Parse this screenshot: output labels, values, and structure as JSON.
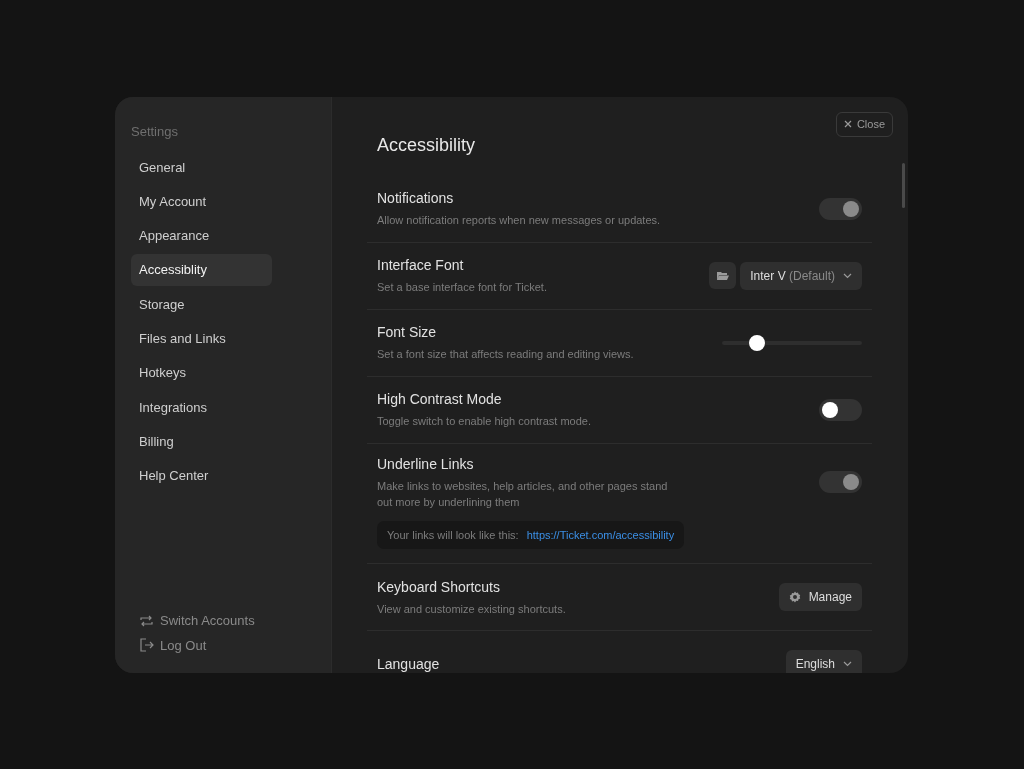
{
  "sidebar": {
    "heading": "Settings",
    "items": [
      {
        "label": "General",
        "selected": false
      },
      {
        "label": "My Account",
        "selected": false
      },
      {
        "label": "Appearance",
        "selected": false
      },
      {
        "label": "Accessiblity",
        "selected": true
      },
      {
        "label": "Storage",
        "selected": false
      },
      {
        "label": "Files and Links",
        "selected": false
      },
      {
        "label": "Hotkeys",
        "selected": false
      },
      {
        "label": "Integrations",
        "selected": false
      },
      {
        "label": "Billing",
        "selected": false
      },
      {
        "label": "Help Center",
        "selected": false
      }
    ],
    "footer": [
      {
        "kind": "switch",
        "label": "Switch Accounts"
      },
      {
        "kind": "logout",
        "label": "Log Out"
      }
    ]
  },
  "close_button": "Close",
  "title": "Accessibility",
  "settings": [
    {
      "kind": "toggle",
      "title": "Notifications",
      "description": "Allow notification reports when new messages or updates.",
      "on": true
    },
    {
      "kind": "font",
      "title": "Interface Font",
      "description": "Set a base interface font for Ticket.",
      "value": "Inter V",
      "note": "(Default)"
    },
    {
      "kind": "slider",
      "title": "Font Size",
      "description": "Set a font size that affects reading and editing views.",
      "level": 0.25
    },
    {
      "kind": "toggle",
      "title": "High Contrast Mode",
      "description": "Toggle switch to enable high contrast mode.",
      "on": false
    },
    {
      "kind": "toggle",
      "title": "Underline Links",
      "description": "Make links to websites, help articles, and other pages stand out more by underlining them",
      "on": true,
      "preview": {
        "text": "Your links will look like this:",
        "link": "https://Ticket.com/accessibility"
      }
    },
    {
      "kind": "button",
      "title": "Keyboard Shortcuts",
      "description": "View and customize existing shortcuts.",
      "button": "Manage"
    },
    {
      "kind": "select",
      "title": "Language",
      "value": "English"
    }
  ]
}
